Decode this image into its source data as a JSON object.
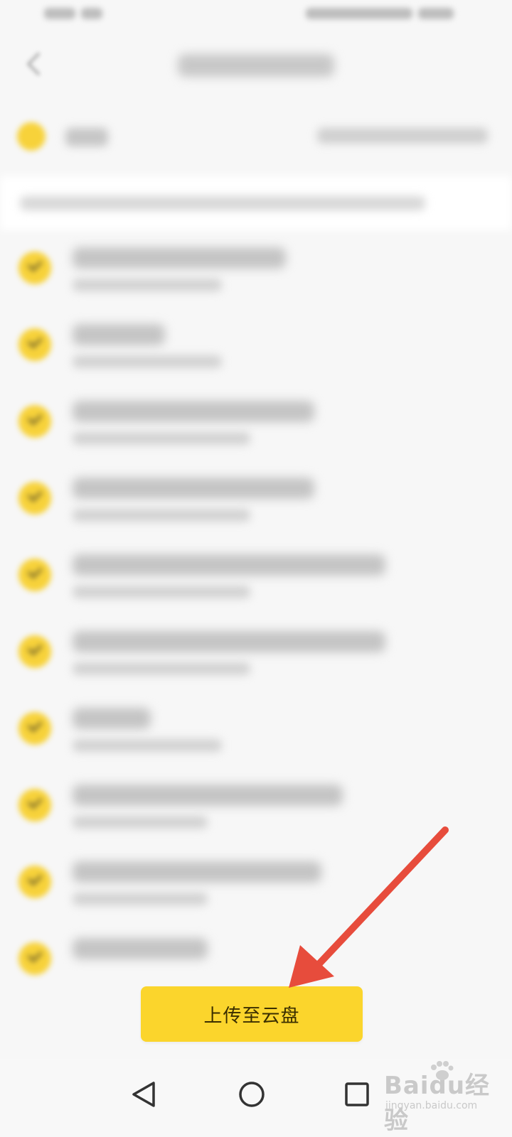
{
  "upload_button": {
    "label": "上传至云盘",
    "color": "#fbd52c"
  },
  "annotation": {
    "arrow_color": "#e74c3c"
  },
  "icons": {
    "status_signal": "signal-icon",
    "header_back": "back-arrow-icon",
    "row_check": "check-circle-icon",
    "nav_back": "triangle-back-icon",
    "nav_home": "circle-home-icon",
    "nav_recent": "square-recent-icon"
  },
  "watermark": {
    "logo": "Baidu经验",
    "url": "jingyan.baidu.com"
  },
  "list": {
    "items_visible": 10,
    "all_selected": true,
    "accent": "#f7d23a"
  }
}
